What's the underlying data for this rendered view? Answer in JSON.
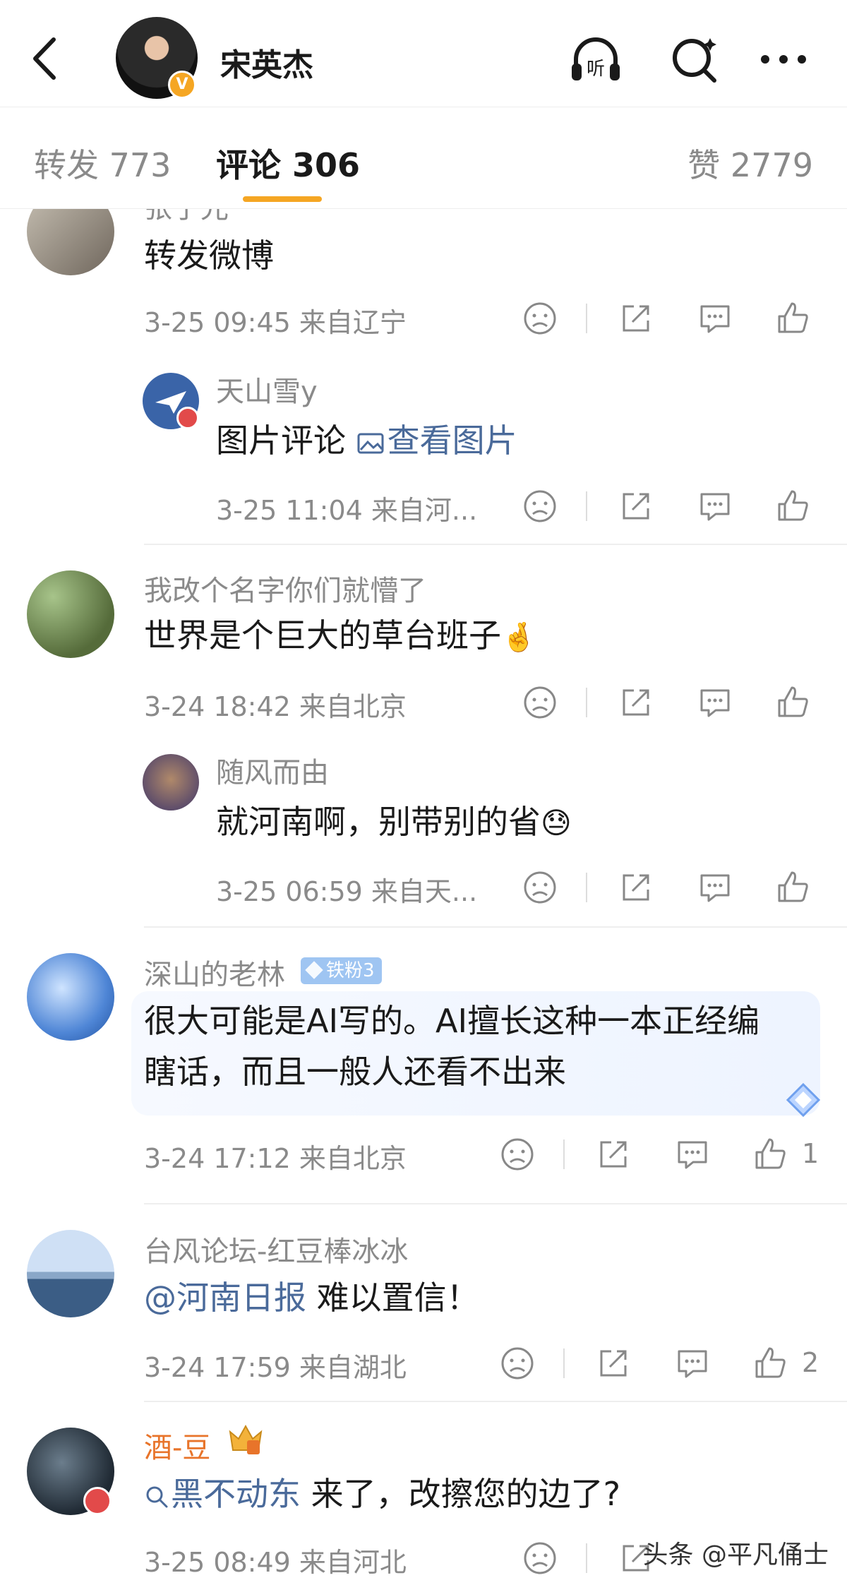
{
  "header": {
    "user_name": "宋英杰",
    "verified_badge": "V",
    "icons": [
      "back-icon",
      "listen-icon",
      "search-icon",
      "more-icon"
    ],
    "listen_label": "听"
  },
  "tabs": [
    {
      "label": "转发 773"
    },
    {
      "label": "评论 306"
    },
    {
      "label": "赞 2779"
    }
  ],
  "comments": [
    {
      "name": "张子光",
      "text": "转发微博",
      "meta": "3-25 09:45 来自辽宁",
      "reply": {
        "name": "天山雪y",
        "text": "图片评论 ",
        "link": "查看图片",
        "meta": "3-25 11:04 来自河..."
      }
    },
    {
      "name": "我改个名字你们就懵了",
      "text": "世界是个巨大的草台班子",
      "meta": "3-24 18:42 来自北京",
      "reply": {
        "name": "随风而由",
        "text": "就河南啊，别带别的省",
        "meta": "3-25 06:59 来自天..."
      }
    },
    {
      "name": "深山的老林",
      "badge": "铁粉3",
      "text_line1": "很大可能是AI写的。AI擅长这种一本正经编",
      "text_line2": "瞎话，而且一般人还看不出来",
      "meta": "3-24 17:12 来自北京",
      "likes": "1"
    },
    {
      "name": "台风论坛-红豆棒冰冰",
      "mention": "@河南日报",
      "text": " 难以置信！",
      "meta": "3-24 17:59 来自湖北",
      "likes": "2"
    },
    {
      "name": "酒-豆",
      "search_link": "黑不动东",
      "text": " 来了，改擦您的边了?",
      "meta": "3-25 08:49 来自河北"
    }
  ],
  "watermark": "头条 @平凡俑士",
  "colors": {
    "accent": "#f5a623",
    "link": "#4a6a9a",
    "muted": "#8a8a8a",
    "name_orange": "#e8742a"
  }
}
